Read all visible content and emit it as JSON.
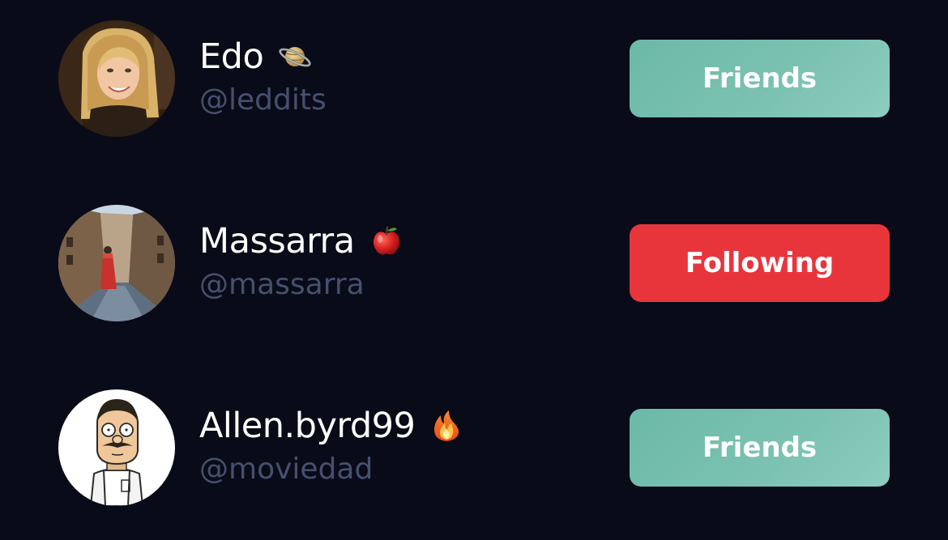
{
  "users": [
    {
      "display_name": "Edo",
      "emoji": "saturn",
      "handle": "@leddits",
      "action_label": "Friends",
      "action_color": "#76bfae"
    },
    {
      "display_name": "Massarra",
      "emoji": "red-apple",
      "handle": "@massarra",
      "action_label": "Following",
      "action_color": "#e8353c"
    },
    {
      "display_name": "Allen.byrd99",
      "emoji": "fire",
      "handle": "@moviedad",
      "action_label": "Friends",
      "action_color": "#76bfae"
    }
  ],
  "colors": {
    "background": "#0a0b18",
    "name_text": "#ffffff",
    "handle_text": "#46506e",
    "friends_button": "#76bfae",
    "following_button": "#e8353c"
  }
}
